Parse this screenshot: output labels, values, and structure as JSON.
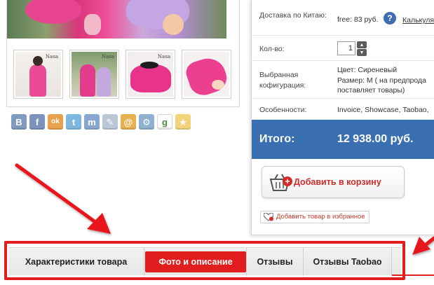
{
  "gallery": {
    "thumbnail_stamp": "Nasa",
    "thumbnails": [
      "thumb-1",
      "thumb-2",
      "thumb-3",
      "thumb-4"
    ]
  },
  "share": {
    "buttons": [
      {
        "name": "vk-icon",
        "glyph": "B"
      },
      {
        "name": "facebook-icon",
        "glyph": "f"
      },
      {
        "name": "odnoklassniki-icon",
        "glyph": "ok"
      },
      {
        "name": "twitter-icon",
        "glyph": "t"
      },
      {
        "name": "moimir-icon",
        "glyph": "m"
      },
      {
        "name": "livejournal-icon",
        "glyph": "✎"
      },
      {
        "name": "mailru-icon",
        "glyph": "@"
      },
      {
        "name": "settings-icon",
        "glyph": "⚙"
      },
      {
        "name": "google-plus-icon",
        "glyph": "g"
      },
      {
        "name": "star-icon",
        "glyph": "★"
      }
    ]
  },
  "product": {
    "shipping": {
      "label": "Доставка по Китаю:",
      "value": "free: 83 руб.",
      "help_icon": "?",
      "calculator_link": "Калькуля"
    },
    "quantity": {
      "label": "Кол-во:",
      "value": "1"
    },
    "configuration": {
      "label": "Выбранная кофигурация:",
      "color_line": "Цвет: Сиреневый",
      "size_line": "Размер: M ( на предпрода",
      "size_line2": "поставляет товары)"
    },
    "features": {
      "label": "Особенности:",
      "value": "Invoice, Showcase, Taobao,"
    },
    "total": {
      "label": "Итого:",
      "value": "12 938.00 руб."
    },
    "add_to_cart": "Добавить в корзину",
    "add_to_favorites": "Добавить товар в избранное"
  },
  "tabs": [
    {
      "label": "Характеристики товара",
      "active": false
    },
    {
      "label": "Фото и описание",
      "active": true
    },
    {
      "label": "Отзывы",
      "active": false
    },
    {
      "label": "Отзывы Taobao",
      "active": false
    }
  ],
  "colors": {
    "accent_red": "#e21d1d",
    "total_blue": "#3a6fb2",
    "help_blue": "#3f6db2"
  }
}
